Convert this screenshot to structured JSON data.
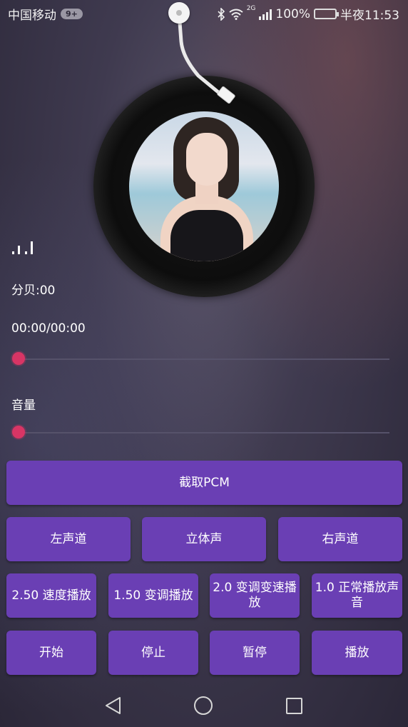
{
  "status_bar": {
    "carrier": "中国移动",
    "badge": "9+",
    "network": "2G",
    "battery": "100%",
    "time": "半夜11:53"
  },
  "player": {
    "db": "分贝:00",
    "time": "00:00/00:00",
    "volume_label": "音量",
    "progress_fraction": 0.0,
    "volume_fraction": 0.0
  },
  "buttons": {
    "capture_pcm": "截取PCM",
    "left_channel": "左声道",
    "stereo": "立体声",
    "right_channel": "右声道",
    "speed_250": "2.50 速度播放",
    "pitch_150": "1.50 变调播放",
    "pitch_speed_20": "2.0 变调变速播放",
    "normal_10": "1.0 正常播放声音",
    "start": "开始",
    "stop": "停止",
    "pause": "暂停",
    "play": "播放"
  },
  "colors": {
    "button": "#6a3fb4",
    "slider_accent": "#d83565",
    "battery": "#3fcf5e"
  },
  "icons": [
    "bluetooth-icon",
    "wifi-icon",
    "signal-icon",
    "battery-icon",
    "equalizer-icon",
    "back-icon",
    "home-icon",
    "recent-apps-icon"
  ]
}
